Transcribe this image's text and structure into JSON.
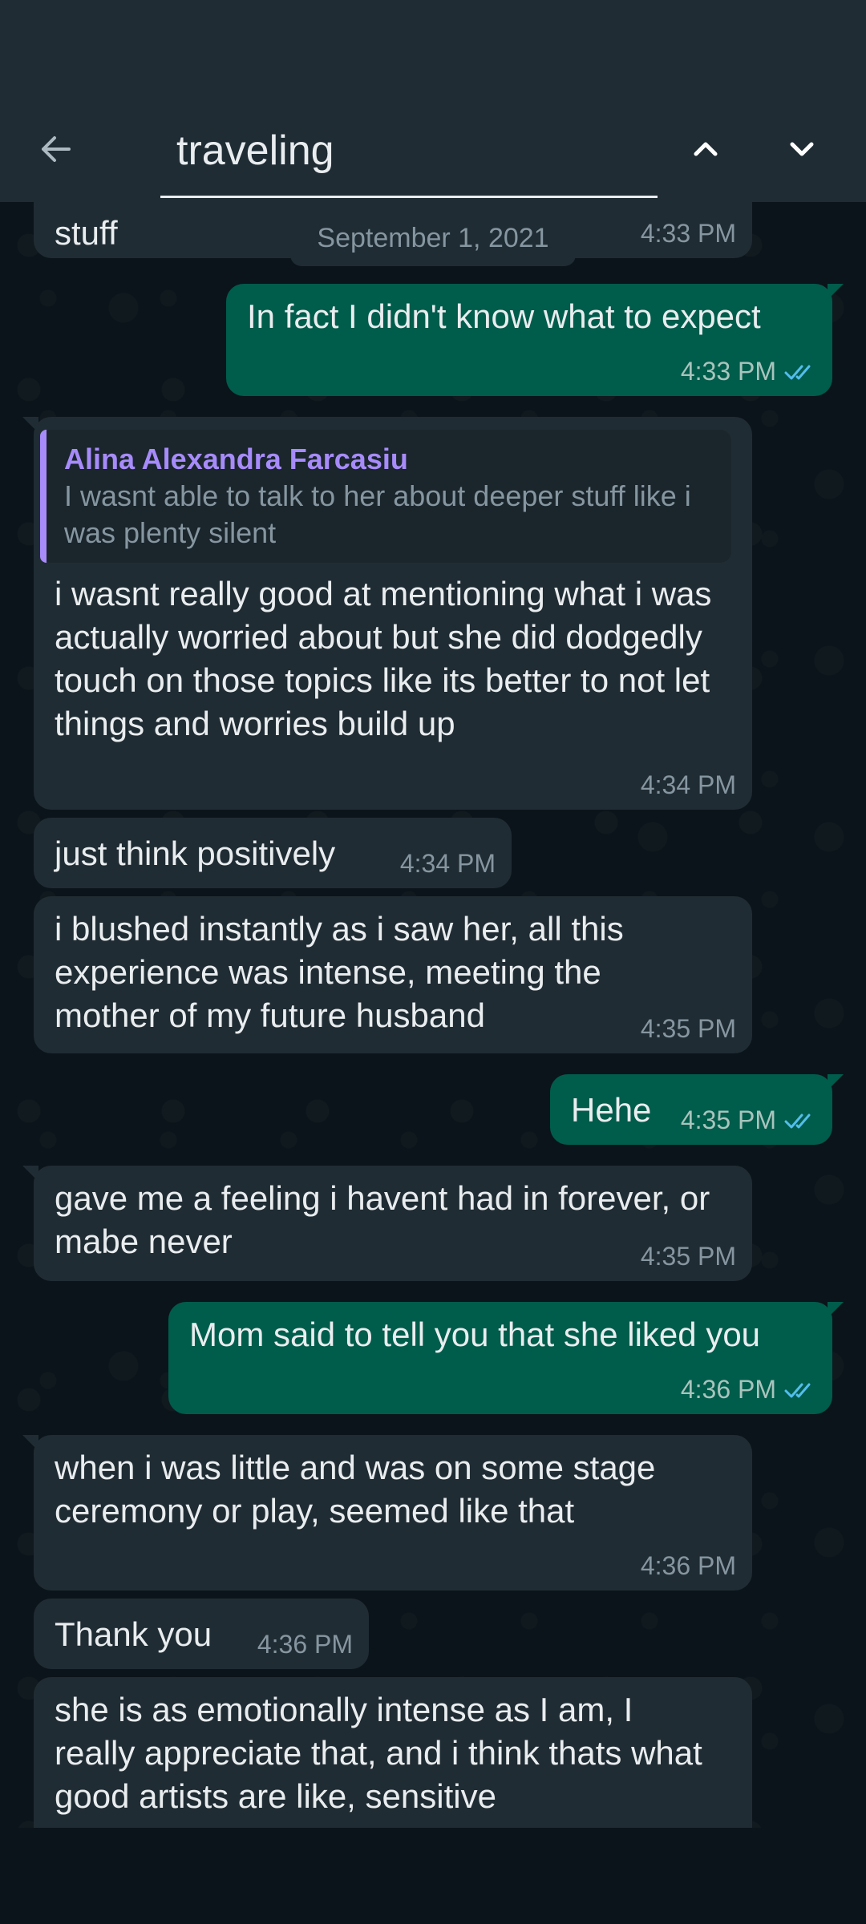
{
  "search": {
    "query": "traveling"
  },
  "date_chip": "September 1, 2021",
  "messages": [
    {
      "text": "stuff",
      "time": "4:33 PM"
    },
    {
      "text": "In fact I didn't know what to expect",
      "time": "4:33 PM"
    },
    {
      "quote_author": "Alina Alexandra Farcasiu",
      "quote_text": "I wasnt able to talk to her about deeper stuff like i was plenty silent",
      "text": "i wasnt really good at mentioning what i was actually worried about but she did dodgedly touch on those topics like its better to not let things and worries build up",
      "time": "4:34 PM"
    },
    {
      "text": "just think positively",
      "time": "4:34 PM"
    },
    {
      "text": "i blushed instantly as i saw her, all this experience was intense, meeting the mother of my future husband",
      "time": "4:35 PM"
    },
    {
      "text": "Hehe",
      "time": "4:35 PM"
    },
    {
      "text": "gave me a feeling i havent had in forever, or mabe never",
      "time": "4:35 PM"
    },
    {
      "text": "Mom said to tell you that she liked you",
      "time": "4:36 PM"
    },
    {
      "text": "when i was little and was on some stage ceremony or play, seemed like that",
      "time": "4:36 PM"
    },
    {
      "text": "Thank you",
      "time": "4:36 PM"
    },
    {
      "text": "she is as emotionally intense as I am, I really appreciate that, and i think thats what good artists are like, sensitive",
      "time": ""
    }
  ]
}
